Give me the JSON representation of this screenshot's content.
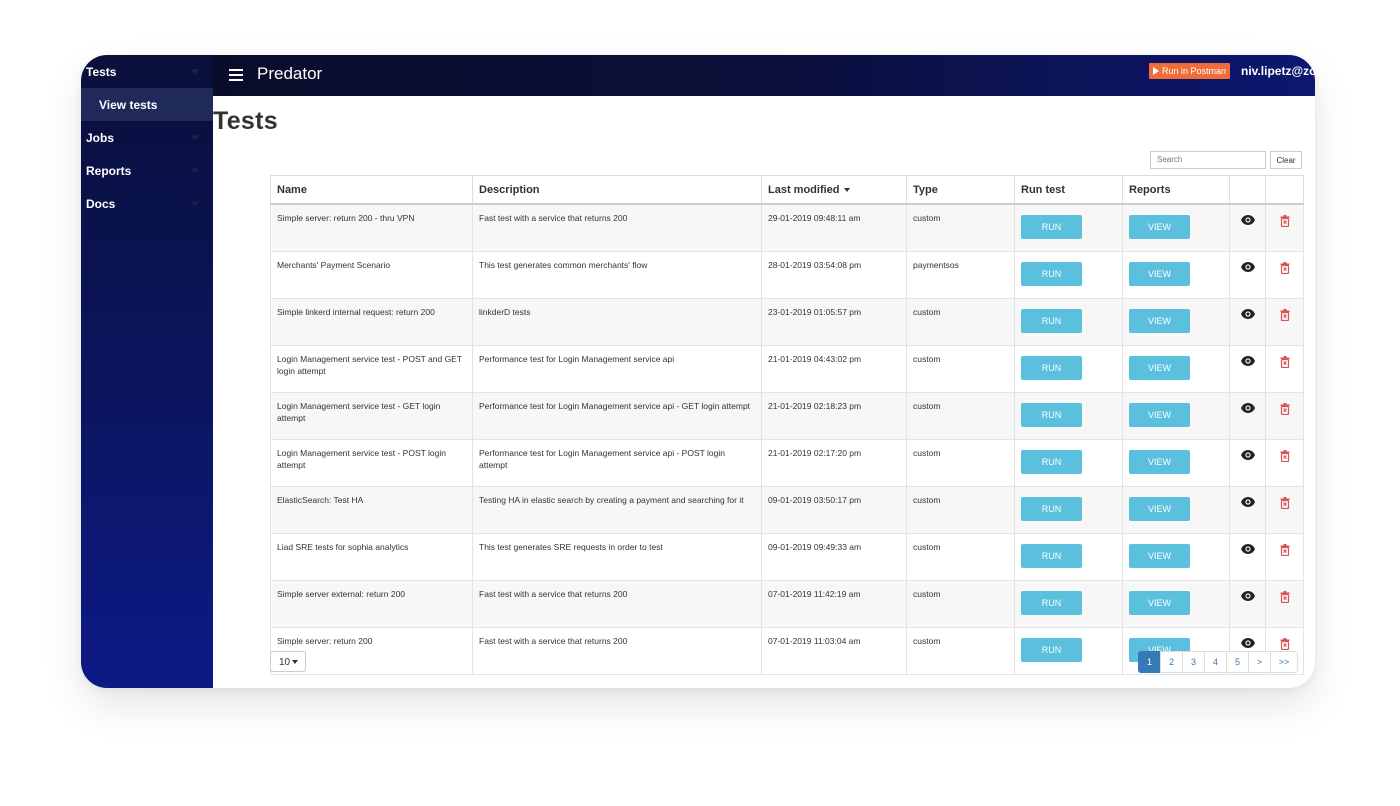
{
  "sidebar": {
    "items": [
      {
        "label": "Tests"
      },
      {
        "label": "View tests"
      },
      {
        "label": "Jobs"
      },
      {
        "label": "Reports"
      },
      {
        "label": "Docs"
      }
    ]
  },
  "header": {
    "title": "Predator",
    "postman_label": "Run in Postman",
    "user": "niv.lipetz@zo"
  },
  "page": {
    "title": "Tests",
    "search_placeholder": "Search",
    "clear_label": "Clear"
  },
  "table": {
    "columns": [
      "Name",
      "Description",
      "Last modified",
      "Type",
      "Run test",
      "Reports"
    ],
    "run_label": "RUN",
    "view_label": "VIEW",
    "rows": [
      {
        "name": "Simple server: return 200 - thru VPN",
        "description": "Fast test with a service that returns 200",
        "modified": "29-01-2019 09:48:11 am",
        "type": "custom"
      },
      {
        "name": "Merchants' Payment Scenario",
        "description": "This test generates common merchants' flow",
        "modified": "28-01-2019 03:54:08 pm",
        "type": "paymentsos"
      },
      {
        "name": "Simple linkerd internal request: return 200",
        "description": "linkderD tests",
        "modified": "23-01-2019 01:05:57 pm",
        "type": "custom"
      },
      {
        "name": "Login Management service test - POST and GET login attempt",
        "description": "Performance test for Login Management service api",
        "modified": "21-01-2019 04:43:02 pm",
        "type": "custom"
      },
      {
        "name": "Login Management service test - GET login attempt",
        "description": "Performance test for Login Management service api - GET login attempt",
        "modified": "21-01-2019 02:18:23 pm",
        "type": "custom"
      },
      {
        "name": "Login Management service test - POST login attempt",
        "description": "Performance test for Login Management service api - POST login attempt",
        "modified": "21-01-2019 02:17:20 pm",
        "type": "custom"
      },
      {
        "name": "ElasticSearch: Test HA",
        "description": "Testing HA in elastic search by creating a payment and searching for it",
        "modified": "09-01-2019 03:50:17 pm",
        "type": "custom"
      },
      {
        "name": "Liad SRE tests for sophia analytics",
        "description": "This test generates SRE requests in order to test",
        "modified": "09-01-2019 09:49:33 am",
        "type": "custom"
      },
      {
        "name": "Simple server external: return 200",
        "description": "Fast test with a service that returns 200",
        "modified": "07-01-2019 11:42:19 am",
        "type": "custom"
      },
      {
        "name": "Simple server: return 200",
        "description": "Fast test with a service that returns 200",
        "modified": "07-01-2019 11:03:04 am",
        "type": "custom"
      }
    ]
  },
  "pager": {
    "page_size": "10",
    "pages": [
      "1",
      "2",
      "3",
      "4",
      "5",
      ">",
      ">>"
    ],
    "active": "1"
  },
  "colors": {
    "sidebar": "#0b1560",
    "button": "#5bc0de",
    "delete": "#d9534f",
    "pagination_active": "#337ab7",
    "postman": "#ef6c3b"
  }
}
